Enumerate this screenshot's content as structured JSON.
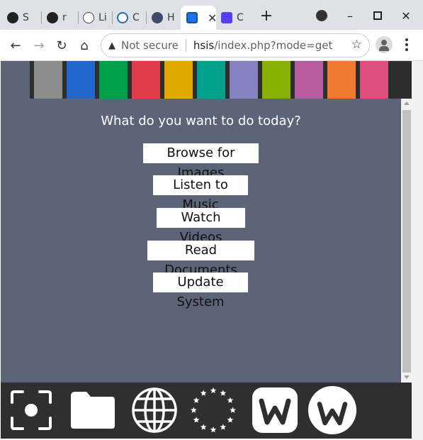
{
  "tabs": [
    {
      "label": "S",
      "icon": "github-icon"
    },
    {
      "label": "r",
      "icon": "github-icon"
    },
    {
      "label": "Li",
      "icon": "wikipedia-icon"
    },
    {
      "label": "C",
      "icon": "debian-icon"
    },
    {
      "label": "H",
      "icon": "w-logo-icon"
    },
    {
      "label": "",
      "icon": "app-icon",
      "active": true
    },
    {
      "label": "C",
      "icon": "s-icon"
    }
  ],
  "toolbar": {
    "security": "Not secure",
    "host": "hsis",
    "path": "/index.php?mode=get"
  },
  "page": {
    "question": "What do you want to do today?",
    "buttons": [
      "Browse for Images",
      "Listen to Music",
      "Watch Videos",
      "Read Documents",
      "Update System"
    ]
  },
  "colors": {
    "page_bg": "#5d6477",
    "strip_swatches": [
      "#8c8c8c",
      "#2266cc",
      "#00a04a",
      "#dd3c48",
      "#e0aa00",
      "#00a08c",
      "#8482c0",
      "#88b000",
      "#b85ca0",
      "#ef7a30",
      "#dd4f7e"
    ]
  },
  "dock": {
    "items": [
      "screenshot-icon",
      "folder-icon",
      "globe-icon",
      "eu-stars-icon",
      "w-app-icon",
      "w-circle-icon"
    ]
  }
}
